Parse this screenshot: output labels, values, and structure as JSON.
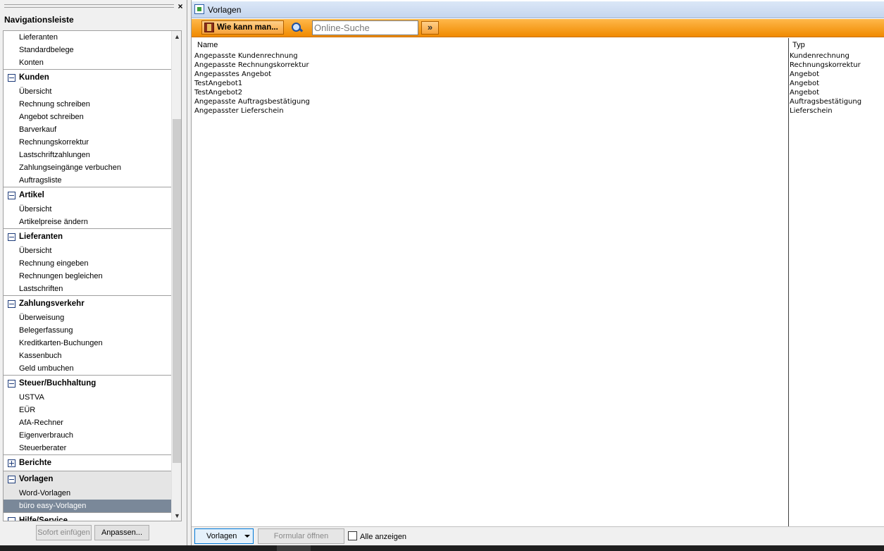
{
  "nav": {
    "title": "Navigationsleiste",
    "close_label": "×",
    "scroll_up": "▲",
    "scroll_down": "▼",
    "top_items": [
      "Lieferanten",
      "Standardbelege",
      "Konten"
    ],
    "groups": [
      {
        "label": "Kunden",
        "expanded": true,
        "items": [
          "Übersicht",
          "Rechnung schreiben",
          "Angebot schreiben",
          "Barverkauf",
          "Rechnungskorrektur",
          "Lastschriftzahlungen",
          "Zahlungseingänge verbuchen",
          "Auftragsliste"
        ]
      },
      {
        "label": "Artikel",
        "expanded": true,
        "items": [
          "Übersicht",
          "Artikelpreise ändern"
        ]
      },
      {
        "label": "Lieferanten",
        "expanded": true,
        "items": [
          "Übersicht",
          "Rechnung eingeben",
          "Rechnungen begleichen",
          "Lastschriften"
        ]
      },
      {
        "label": "Zahlungsverkehr",
        "expanded": true,
        "items": [
          "Überweisung",
          "Belegerfassung",
          "Kreditkarten-Buchungen",
          "Kassenbuch",
          "Geld umbuchen"
        ]
      },
      {
        "label": "Steuer/Buchhaltung",
        "expanded": true,
        "items": [
          "USTVA",
          "EÜR",
          "AfA-Rechner",
          "Eigenverbrauch",
          "Steuerberater"
        ]
      },
      {
        "label": "Berichte",
        "expanded": false,
        "items": []
      },
      {
        "label": "Vorlagen",
        "expanded": true,
        "items": [
          "Word-Vorlagen",
          "büro easy-Vorlagen"
        ]
      },
      {
        "label": "Hilfe/Service",
        "expanded": true,
        "items": []
      }
    ],
    "selected_item": "büro easy-Vorlagen",
    "buttons": {
      "insert": "Sofort einfügen",
      "customize": "Anpassen..."
    }
  },
  "main": {
    "title": "Vorlagen",
    "toolbar": {
      "help_label": "Wie kann man...",
      "search_placeholder": "Online-Suche",
      "go_label": "»"
    },
    "columns": {
      "name": "Name",
      "type": "Typ"
    },
    "rows": [
      {
        "name": "Angepasste Kundenrechnung",
        "type": "Kundenrechnung"
      },
      {
        "name": "Angepasste Rechnungskorrektur",
        "type": "Rechnungskorrektur"
      },
      {
        "name": "Angepasstes Angebot",
        "type": "Angebot"
      },
      {
        "name": "TestAngebot1",
        "type": "Angebot"
      },
      {
        "name": "TestAngebot2",
        "type": "Angebot"
      },
      {
        "name": "Angepasste Auftragsbestätigung",
        "type": "Auftragsbestätigung"
      },
      {
        "name": "Angepasster Lieferschein",
        "type": "Lieferschein"
      }
    ],
    "bottom": {
      "templates_label": "Vorlagen",
      "open_form_label": "Formular öffnen",
      "show_all_label": "Alle anzeigen",
      "show_all_checked": false
    }
  },
  "colors": {
    "toolbar_orange": "#f7a23a",
    "selection": "#7a8899",
    "title_blue": "#c5d6ee"
  }
}
